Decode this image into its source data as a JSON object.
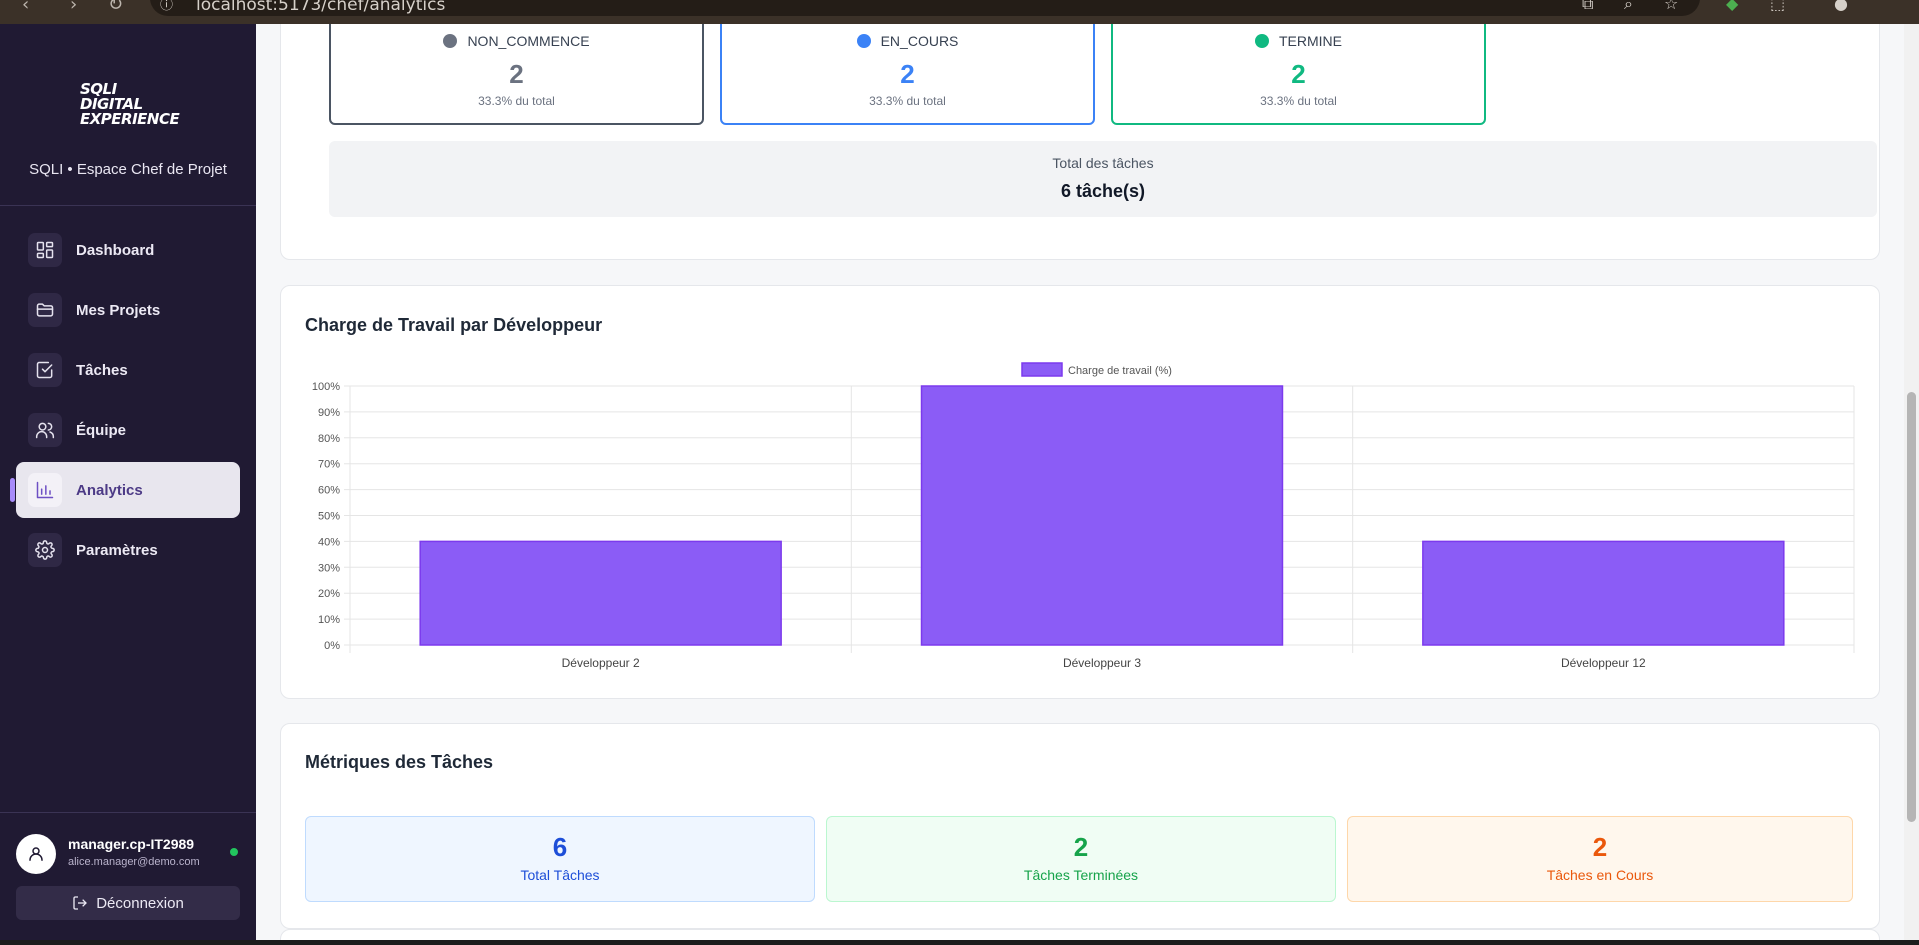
{
  "browser": {
    "url": "localhost:5173/chef/analytics"
  },
  "sidebar": {
    "logo_lines": [
      "SQLI",
      "DIGITAL",
      "EXPERIENCE"
    ],
    "subtitle": "SQLI • Espace Chef de Projet",
    "items": [
      {
        "label": "Dashboard",
        "icon": "dashboard-icon",
        "active": false
      },
      {
        "label": "Mes Projets",
        "icon": "folder-icon",
        "active": false
      },
      {
        "label": "Tâches",
        "icon": "checkbox-icon",
        "active": false
      },
      {
        "label": "Équipe",
        "icon": "users-icon",
        "active": false
      },
      {
        "label": "Analytics",
        "icon": "bar-chart-icon",
        "active": true
      },
      {
        "label": "Paramètres",
        "icon": "gear-icon",
        "active": false
      }
    ],
    "user": {
      "name": "manager.cp-IT2989",
      "email": "alice.manager@demo.com",
      "online": true
    },
    "logout_label": "Déconnexion"
  },
  "status_summary": {
    "items": [
      {
        "label": "NON_COMMENCE",
        "count": "2",
        "percent": "33.3% du total",
        "color": "#6b7280",
        "border": "#4b5563"
      },
      {
        "label": "EN_COURS",
        "count": "2",
        "percent": "33.3% du total",
        "color": "#3b82f6",
        "border": "#3b82f6"
      },
      {
        "label": "TERMINE",
        "count": "2",
        "percent": "33.3% du total",
        "color": "#10b981",
        "border": "#10b981"
      }
    ],
    "total_label": "Total des tâches",
    "total_value": "6 tâche(s)"
  },
  "workload": {
    "title": "Charge de Travail par Développeur"
  },
  "chart_data": {
    "type": "bar",
    "title": "",
    "categories": [
      "Développeur 2",
      "Développeur 3",
      "Développeur 12"
    ],
    "series": [
      {
        "name": "Charge de travail (%)",
        "values": [
          40,
          100,
          40
        ],
        "color": "#8b5cf6"
      }
    ],
    "ylim": [
      0,
      100
    ],
    "yticks": [
      "0%",
      "10%",
      "20%",
      "30%",
      "40%",
      "50%",
      "60%",
      "70%",
      "80%",
      "90%",
      "100%"
    ],
    "grid": true,
    "legend": "top-center"
  },
  "task_metrics": {
    "title": "Métriques des Tâches",
    "items": [
      {
        "value": "6",
        "label": "Total Tâches",
        "color": "#1d4ed8",
        "bg": "#eff6ff",
        "border": "#bfdbfe"
      },
      {
        "value": "2",
        "label": "Tâches Terminées",
        "color": "#16a34a",
        "bg": "#f0fdf4",
        "border": "#bbf7d0"
      },
      {
        "value": "2",
        "label": "Tâches en Cours",
        "color": "#ea580c",
        "bg": "#fff7ed",
        "border": "#fed7aa"
      }
    ]
  }
}
